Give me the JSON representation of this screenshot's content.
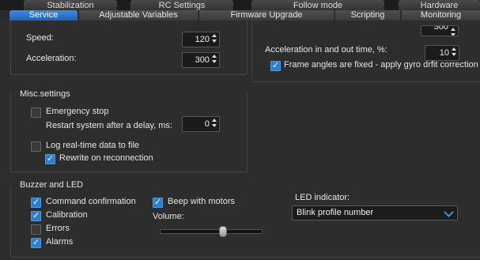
{
  "tabs_top": [
    "Stabilization",
    "RC Settings",
    "Follow mode",
    "Hardware"
  ],
  "tabs_bottom": [
    "Service",
    "Adjustable Variables",
    "Firmware Upgrade",
    "Scripting",
    "Monitoring"
  ],
  "active_tab": "Service",
  "motion": {
    "speed_label": "Speed:",
    "speed_value": "120",
    "accel_label": "Acceleration:",
    "accel_value": "300",
    "top_right_value": "300",
    "accel_inout_label": "Acceleration in and out time, %:",
    "accel_inout_value": "10",
    "frame_fixed_label": "Frame angles are fixed - apply gyro drfit correction",
    "frame_fixed_checked": true
  },
  "misc": {
    "title": "Misc.settings",
    "emergency_label": "Emergency stop",
    "emergency_checked": false,
    "restart_label": "Restart system after a delay, ms:",
    "restart_value": "0",
    "log_label": "Log real-time data to file",
    "log_checked": false,
    "rewrite_label": "Rewrite on reconnection",
    "rewrite_checked": true
  },
  "buzzer": {
    "title": "Buzzer and LED",
    "items": [
      {
        "label": "Command confirmation",
        "checked": true
      },
      {
        "label": "Calibration",
        "checked": true
      },
      {
        "label": "Errors",
        "checked": false
      },
      {
        "label": "Alarms",
        "checked": true
      }
    ],
    "beep_label": "Beep with motors",
    "beep_checked": true,
    "volume_label": "Volume:",
    "volume_fraction": 0.62,
    "led_label": "LED indicator:",
    "led_value": "Blink profile number"
  }
}
